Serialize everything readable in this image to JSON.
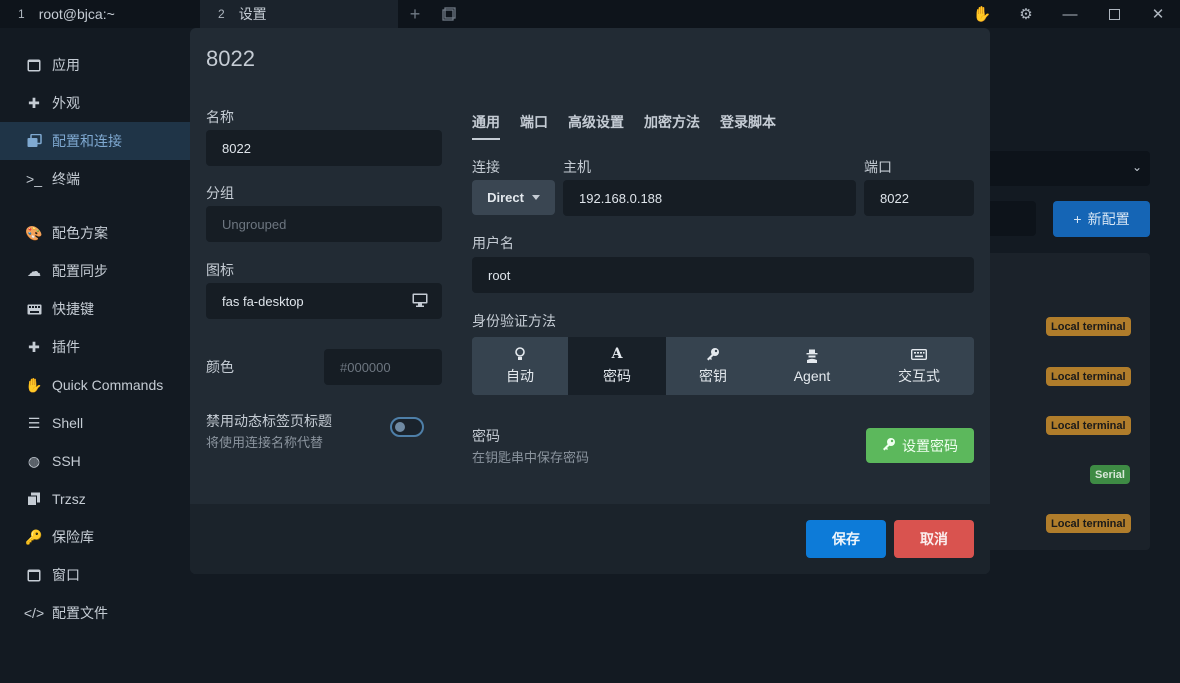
{
  "titlebar": {
    "tabs": [
      {
        "num": "1",
        "label": "root@bjca:~"
      },
      {
        "num": "2",
        "label": "设置"
      }
    ]
  },
  "sidebar": {
    "items": [
      {
        "label": "应用",
        "icon": "window-icon"
      },
      {
        "label": "外观",
        "icon": "puzzle-icon"
      },
      {
        "label": "配置和连接",
        "icon": "copy-icon",
        "active": true
      },
      {
        "label": "终端",
        "icon": "terminal-icon"
      },
      {
        "label": "配色方案",
        "icon": "palette-icon"
      },
      {
        "label": "配置同步",
        "icon": "cloud-icon"
      },
      {
        "label": "快捷键",
        "icon": "keyboard-icon"
      },
      {
        "label": "插件",
        "icon": "plugin-icon"
      },
      {
        "label": "Quick Commands",
        "icon": "hand-icon"
      },
      {
        "label": "Shell",
        "icon": "list-icon"
      },
      {
        "label": "SSH",
        "icon": "globe-icon"
      },
      {
        "label": "Trzsz",
        "icon": "files-icon"
      },
      {
        "label": "保险库",
        "icon": "key-icon"
      },
      {
        "label": "窗口",
        "icon": "window-icon"
      },
      {
        "label": "配置文件",
        "icon": "code-icon"
      }
    ]
  },
  "background": {
    "new_config_label": "新配置",
    "badges": [
      "Local terminal",
      "Local terminal",
      "Local terminal",
      "Serial",
      "Local terminal"
    ]
  },
  "modal": {
    "title": "8022",
    "name_label": "名称",
    "name_value": "8022",
    "group_label": "分组",
    "group_placeholder": "Ungrouped",
    "icon_label": "图标",
    "icon_value": "fas fa-desktop",
    "color_label": "颜色",
    "color_placeholder": "#000000",
    "dynamic_title_label": "禁用动态标签页标题",
    "dynamic_title_desc": "将使用连接名称代替",
    "tabs": [
      "通用",
      "端口",
      "高级设置",
      "加密方法",
      "登录脚本"
    ],
    "connection_label": "连接",
    "connection_value": "Direct",
    "host_label": "主机",
    "host_value": "192.168.0.188",
    "port_label": "端口",
    "port_value": "8022",
    "username_label": "用户名",
    "username_value": "root",
    "auth_label": "身份验证方法",
    "auth_options": [
      "自动",
      "密码",
      "密钥",
      "Agent",
      "交互式"
    ],
    "auth_selected": "密码",
    "password_label": "密码",
    "password_desc": "在钥匙串中保存密码",
    "set_password_label": "设置密码",
    "save_label": "保存",
    "cancel_label": "取消"
  },
  "colors": {
    "accent": "#0d7bd8",
    "danger": "#d9534f",
    "success": "#5cb85c",
    "local_badge": "#b07d2b",
    "serial_badge": "#3e8b44"
  }
}
